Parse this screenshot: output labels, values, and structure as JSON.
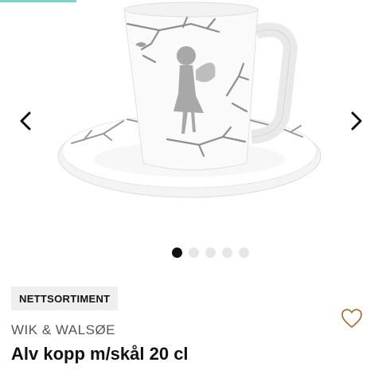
{
  "gallery": {
    "image_alt": "Alv kopp m/skål 20 cl",
    "prev_icon": "chevron-left-icon",
    "next_icon": "chevron-right-icon",
    "slide_count": 5,
    "active_slide": 1
  },
  "product": {
    "badge": "NETTSORTIMENT",
    "brand": "WIK & WALSØE",
    "title": "Alv kopp m/skål 20 cl",
    "favorite_icon": "heart-outline-icon"
  },
  "colors": {
    "accent": "#7fd1c6",
    "heart": "#a07a40",
    "dot_active": "#111111",
    "dot_inactive": "#e6e6e6",
    "badge_bg": "#efefef"
  }
}
